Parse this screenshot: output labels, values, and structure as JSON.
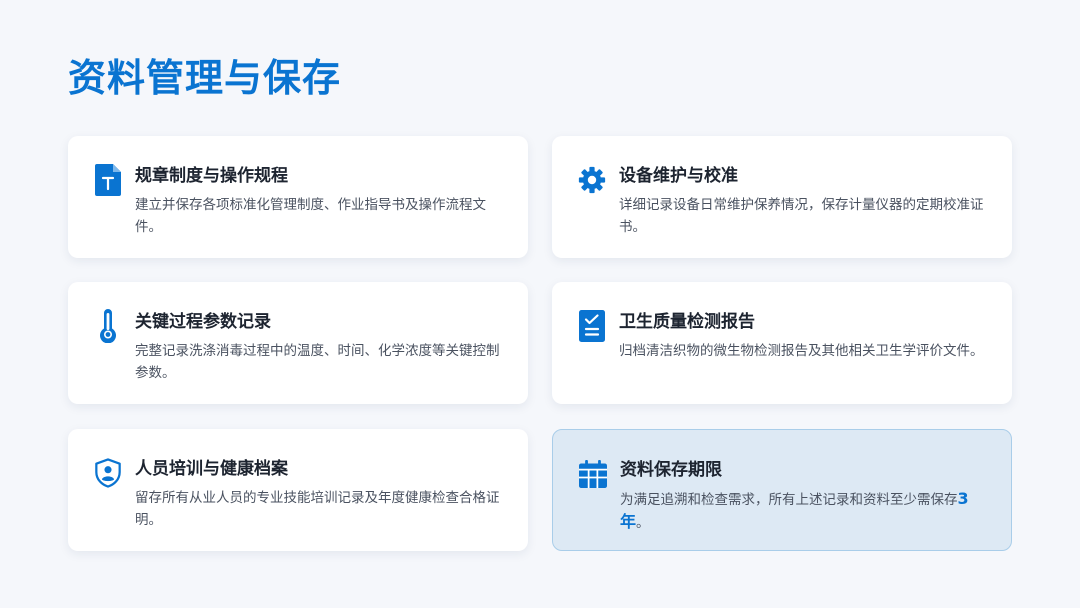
{
  "page": {
    "title": "资料管理与保存"
  },
  "cards": [
    {
      "title": "规章制度与操作规程",
      "desc": "建立并保存各项标准化管理制度、作业指导书及操作流程文件。",
      "icon": "document-text-icon"
    },
    {
      "title": "设备维护与校准",
      "desc": "详细记录设备日常维护保养情况，保存计量仪器的定期校准证书。",
      "icon": "gear-icon"
    },
    {
      "title": "关键过程参数记录",
      "desc": "完整记录洗涤消毒过程中的温度、时间、化学浓度等关键控制参数。",
      "icon": "thermometer-icon"
    },
    {
      "title": "卫生质量检测报告",
      "desc": "归档清洁织物的微生物检测报告及其他相关卫生学评价文件。",
      "icon": "checklist-report-icon"
    },
    {
      "title": "人员培训与健康档案",
      "desc": "留存所有从业人员的专业技能培训记录及年度健康检查合格证明。",
      "icon": "user-shield-icon"
    },
    {
      "title": "资料保存期限",
      "desc_prefix": "为满足追溯和检查需求，所有上述记录和资料至少需保存",
      "desc_emph": "3年",
      "desc_suffix": "。",
      "icon": "calendar-icon"
    }
  ],
  "colors": {
    "accent": "#0a74d1",
    "background": "#f5f7fb",
    "card": "#ffffff",
    "highlight_card": "#dde9f4"
  }
}
